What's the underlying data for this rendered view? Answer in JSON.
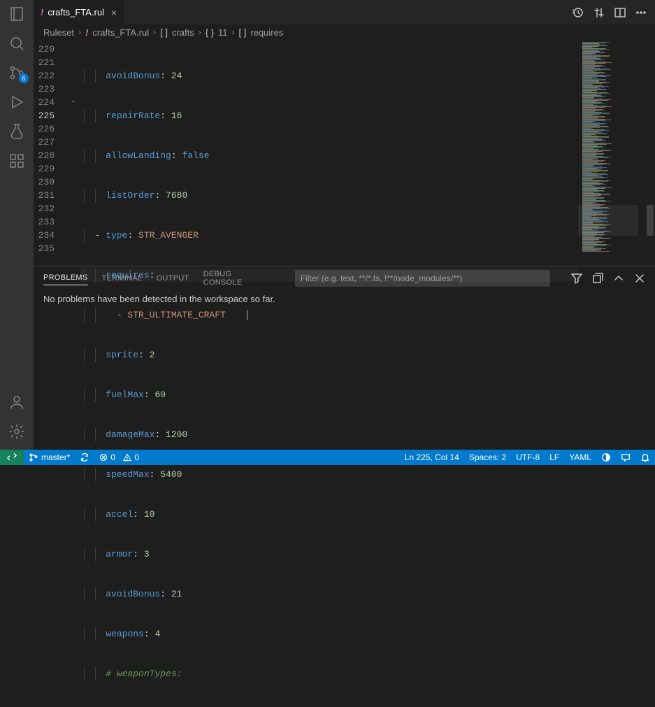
{
  "activityBar": {
    "scmBadge": "6"
  },
  "tab": {
    "name": "crafts_FTA.rul",
    "modifiedMarker": "!"
  },
  "breadcrumb": {
    "p0": "Ruleset",
    "p1": "crafts_FTA.rul",
    "p2": "crafts",
    "p3": "11",
    "p4": "requires"
  },
  "lines": {
    "l220": {
      "num": "220",
      "key": "avoidBonus",
      "val": "24"
    },
    "l221": {
      "num": "221",
      "key": "repairRate",
      "val": "16"
    },
    "l222": {
      "num": "222",
      "key": "allowLanding",
      "val": "false"
    },
    "l223": {
      "num": "223",
      "key": "listOrder",
      "val": "7680"
    },
    "l224": {
      "num": "224",
      "key": "type",
      "val": "STR_AVENGER",
      "fold": "-"
    },
    "l225": {
      "num": "225",
      "key": "requires",
      "val": ""
    },
    "l226": {
      "num": "226",
      "item": "- STR_ULTIMATE_CRAFT"
    },
    "l227": {
      "num": "227",
      "key": "sprite",
      "val": "2"
    },
    "l228": {
      "num": "228",
      "key": "fuelMax",
      "val": "60"
    },
    "l229": {
      "num": "229",
      "key": "damageMax",
      "val": "1200"
    },
    "l230": {
      "num": "230",
      "key": "speedMax",
      "val": "5400"
    },
    "l231": {
      "num": "231",
      "key": "accel",
      "val": "10"
    },
    "l232": {
      "num": "232",
      "key": "armor",
      "val": "3"
    },
    "l233": {
      "num": "233",
      "key": "avoidBonus",
      "val": "21"
    },
    "l234": {
      "num": "234",
      "key": "weapons",
      "val": "4"
    },
    "l235": {
      "num": "235",
      "comment": "# weaponTypes:"
    }
  },
  "panel": {
    "tabs": {
      "problems": "PROBLEMS",
      "terminal": "TERMINAL",
      "output": "OUTPUT",
      "debug": "DEBUG CONSOLE"
    },
    "filterPlaceholder": "Filter (e.g. text, **/*.ts, !**/node_modules/**)",
    "message": "No problems have been detected in the workspace so far."
  },
  "status": {
    "branch": "master*",
    "sync": "",
    "errors": "0",
    "warnings": "0",
    "position": "Ln 225, Col 14",
    "spaces": "Spaces: 2",
    "encoding": "UTF-8",
    "eol": "LF",
    "lang": "YAML"
  }
}
